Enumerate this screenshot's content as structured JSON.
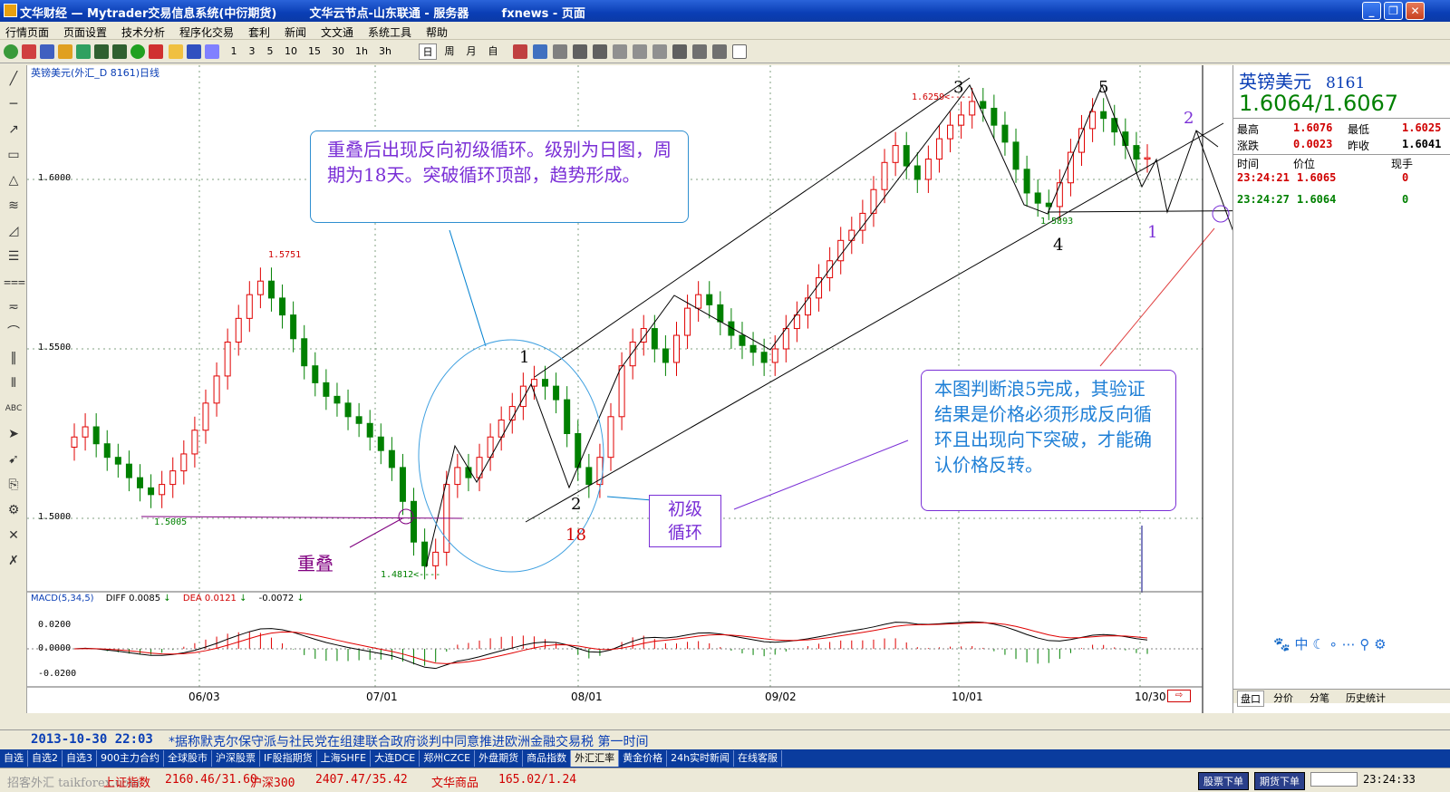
{
  "title_bar": {
    "text": "文华财经 — Mytrader交易信息系统(中衍期货)        文华云节点-山东联通 - 服务器        fxnews - 页面"
  },
  "menu": [
    "行情页面",
    "页面设置",
    "技术分析",
    "程序化交易",
    "套利",
    "新闻",
    "文文通",
    "系统工具",
    "帮助"
  ],
  "toolbar_periods": [
    "1",
    "3",
    "5",
    "10",
    "15",
    "30",
    "1h",
    "3h",
    "日",
    "周",
    "月",
    "自"
  ],
  "chart": {
    "header": "英镑美元(外汇_D 8161)日线",
    "y_ticks": [
      "1.6000",
      "1.5500",
      "1.5000"
    ],
    "x_ticks": [
      "06/03",
      "07/01",
      "08/01",
      "09/02",
      "10/01",
      "10/30"
    ],
    "price_labels": [
      "1.5751",
      "1.5005",
      "1.4812<----",
      "1.6259<----",
      "1.5893"
    ],
    "wave_labels": [
      "1",
      "2",
      "3",
      "4",
      "5",
      "18"
    ],
    "projection_labels": [
      "2",
      "1",
      "3"
    ],
    "ann_box1": "重叠后出现反向初级循环。级别为日图，周期为18天。突破循环顶部，趋势形成。",
    "ann_box2": "本图判断浪5完成，其验证结果是价格必须形成反向循环且出现向下突破，才能确认价格反转。",
    "ann_box3_line1": "初级",
    "ann_box3_line2": "循环",
    "overlap_label": "重叠",
    "macd": {
      "title": "MACD(5,34,5)",
      "diff_label": "DIFF",
      "diff": "0.0085",
      "dea_label": "DEA",
      "dea": "0.0121",
      "macd": "-0.0072",
      "y_ticks": [
        "0.0200",
        "0.0000",
        "-0.0200"
      ]
    }
  },
  "chart_data": {
    "type": "candlestick",
    "title": "英镑美元(外汇_D 8161)日线",
    "x_range": [
      "06/03",
      "10/30"
    ],
    "ylim": [
      1.47,
      1.635
    ],
    "key_points": [
      {
        "label": "高点",
        "value": 1.5751
      },
      {
        "label": "低点",
        "value": 1.5005
      },
      {
        "label": "低点",
        "value": 1.4812
      },
      {
        "label": "高点",
        "value": 1.6259
      },
      {
        "label": "低点",
        "value": 1.5893
      }
    ],
    "closes": [
      1.524,
      1.527,
      1.522,
      1.518,
      1.516,
      1.512,
      1.509,
      1.507,
      1.51,
      1.514,
      1.519,
      1.526,
      1.534,
      1.542,
      1.552,
      1.559,
      1.566,
      1.57,
      1.565,
      1.56,
      1.553,
      1.545,
      1.54,
      1.536,
      1.534,
      1.53,
      1.528,
      1.524,
      1.52,
      1.515,
      1.505,
      1.493,
      1.486,
      1.49,
      1.51,
      1.515,
      1.512,
      1.518,
      1.524,
      1.529,
      1.533,
      1.539,
      1.541,
      1.539,
      1.535,
      1.525,
      1.515,
      1.51,
      1.518,
      1.53,
      1.545,
      1.552,
      1.556,
      1.55,
      1.546,
      1.554,
      1.562,
      1.566,
      1.563,
      1.558,
      1.554,
      1.551,
      1.549,
      1.546,
      1.55,
      1.556,
      1.56,
      1.565,
      1.571,
      1.576,
      1.582,
      1.585,
      1.59,
      1.597,
      1.605,
      1.61,
      1.604,
      1.6,
      1.606,
      1.612,
      1.616,
      1.619,
      1.623,
      1.621,
      1.616,
      1.611,
      1.603,
      1.596,
      1.593,
      1.592,
      1.599,
      1.608,
      1.615,
      1.62,
      1.618,
      1.614,
      1.61,
      1.606,
      1.6064
    ]
  },
  "right_panel": {
    "title": "英镑美元",
    "code": "8161",
    "quote": "1.6064/1.6067",
    "high_label": "最高",
    "high": "1.6076",
    "low_label": "最低",
    "low": "1.6025",
    "chg_label": "涨跌",
    "chg": "0.0023",
    "prev_label": "昨收",
    "prev": "1.6041",
    "col_time": "时间",
    "col_price": "价位",
    "col_vol": "现手",
    "ticks": [
      {
        "time": "23:24:21",
        "price": "1.6065",
        "vol": "0"
      },
      {
        "time": "23:24:27",
        "price": "1.6064",
        "vol": "0"
      }
    ],
    "bottom_tabs": [
      "盘口",
      "分价",
      "分笔",
      "历史统计"
    ],
    "icons_text": "中"
  },
  "news": {
    "time": "2013-10-30 22:03",
    "text": "*据称默克尔保守派与社民党在组建联合政府谈判中同意推进欧洲金融交易税 第一时间"
  },
  "tabs": [
    "自选",
    "自选2",
    "自选3",
    "900主力合约",
    "全球股市",
    "沪深股票",
    "IF股指期货",
    "上海SHFE",
    "大连DCE",
    "郑州CZCE",
    "外盘期货",
    "商品指数",
    "外汇汇率",
    "黄金价格",
    "24h实时新闻",
    "在线客服"
  ],
  "status": {
    "idx1_label": "上证指数",
    "idx1": "2160.46/31.60",
    "idx2_label": "沪深300",
    "idx2": "2407.47/35.42",
    "idx3_label": "文华商品",
    "idx3": "165.02/1.24",
    "btn1": "股票下单",
    "btn2": "期货下单",
    "clock": "23:24:33",
    "watermark": "招客外汇 taikforex.com"
  },
  "colors": {
    "up": "#e00000",
    "down": "#008000",
    "accent": "#6a2fd6",
    "title_blue": "#0a3eb5"
  }
}
